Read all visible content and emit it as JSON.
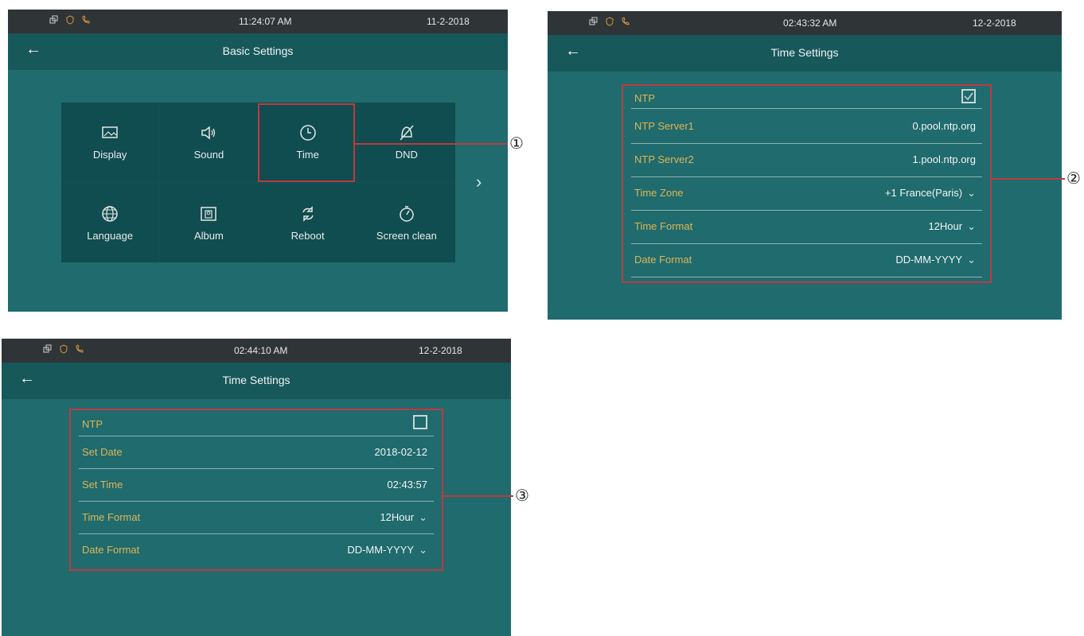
{
  "screens": {
    "basic": {
      "status_time": "11:24:07   AM",
      "status_date": "11-2-2018",
      "title": "Basic Settings",
      "tiles": [
        {
          "label": "Display",
          "icon": "display-icon"
        },
        {
          "label": "Sound",
          "icon": "sound-icon"
        },
        {
          "label": "Time",
          "icon": "clock-icon"
        },
        {
          "label": "DND",
          "icon": "dnd-icon"
        },
        {
          "label": "Language",
          "icon": "globe-icon"
        },
        {
          "label": "Album",
          "icon": "album-icon"
        },
        {
          "label": "Reboot",
          "icon": "reboot-icon"
        },
        {
          "label": "Screen clean",
          "icon": "screen-clean-icon"
        }
      ]
    },
    "ntp_on": {
      "status_time": "02:43:32   AM",
      "status_date": "12-2-2018",
      "title": "Time Settings",
      "rows": [
        {
          "label": "NTP",
          "value": ""
        },
        {
          "label": "NTP Server1",
          "value": "0.pool.ntp.org"
        },
        {
          "label": "NTP Server2",
          "value": "1.pool.ntp.org"
        },
        {
          "label": "Time Zone",
          "value": "+1 France(Paris)"
        },
        {
          "label": "Time Format",
          "value": "12Hour"
        },
        {
          "label": "Date Format",
          "value": "DD-MM-YYYY"
        }
      ],
      "ntp_checked": true
    },
    "ntp_off": {
      "status_time": "02:44:10   AM",
      "status_date": "12-2-2018",
      "title": "Time Settings",
      "rows": [
        {
          "label": "NTP",
          "value": ""
        },
        {
          "label": "Set Date",
          "value": "2018-02-12"
        },
        {
          "label": "Set Time",
          "value": "02:43:57"
        },
        {
          "label": "Time Format",
          "value": "12Hour"
        },
        {
          "label": "Date Format",
          "value": "DD-MM-YYYY"
        }
      ],
      "ntp_checked": false
    }
  },
  "callouts": [
    "①",
    "②",
    "③"
  ],
  "colors": {
    "screen_bg": "#1f6b6e",
    "highlight": "#c0393f",
    "label": "#e0b455",
    "statusbar": "#2f3437"
  }
}
